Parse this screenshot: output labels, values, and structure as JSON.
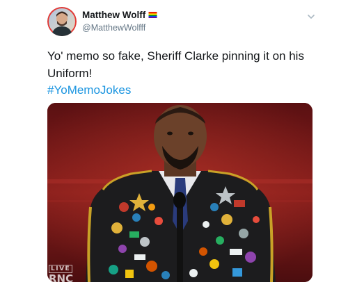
{
  "tweet": {
    "author": {
      "display_name": "Matthew Wolff",
      "handle": "@MatthewWolfff",
      "name_badge_icon": "rainbow-flag-icon",
      "avatar_icon": "user-avatar"
    },
    "menu_icon": "chevron-down-icon",
    "text": "Yo' memo so fake, Sheriff Clarke pinning it on his Uniform!",
    "hashtag": "#YoMemoJokes",
    "hashtag_color": "#1b95e0",
    "media": {
      "kind": "photo",
      "overlay": {
        "live": "LIVE",
        "network": "RNC"
      }
    }
  }
}
